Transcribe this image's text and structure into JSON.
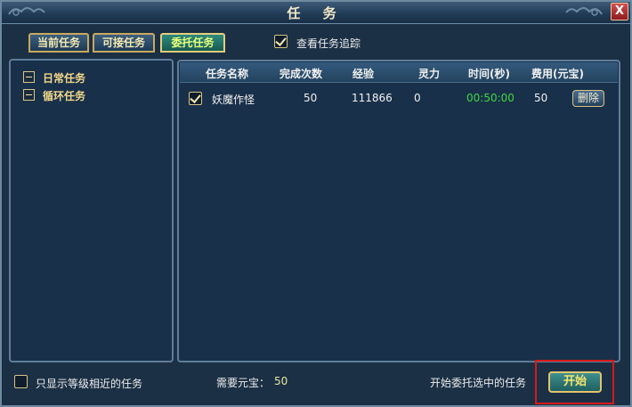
{
  "window": {
    "title": "任 务",
    "close_label": "X"
  },
  "tabs": [
    {
      "label": "当前任务",
      "active": false
    },
    {
      "label": "可接任务",
      "active": false
    },
    {
      "label": "委托任务",
      "active": true
    }
  ],
  "track_checkbox": {
    "label": "查看任务追踪",
    "checked": true
  },
  "tree": [
    {
      "label": "日常任务",
      "expanded": true
    },
    {
      "label": "循环任务",
      "expanded": true
    }
  ],
  "table": {
    "headers": [
      "任务名称",
      "完成次数",
      "经验",
      "灵力",
      "时间(秒)",
      "费用(元宝)"
    ],
    "rows": [
      {
        "checked": true,
        "name": "妖魔作怪",
        "count": "50",
        "exp": "111866",
        "spirit": "0",
        "time": "00:50:00",
        "cost": "50",
        "delete_label": "删除"
      }
    ]
  },
  "footer": {
    "filter_label": "只显示等级相近的任务",
    "filter_checked": false,
    "need_label": "需要元宝：",
    "need_value": "50",
    "start_hint": "开始委托选中的任务",
    "start_label": "开始"
  },
  "colors": {
    "accent": "#c9a85d",
    "highlight": "#d81818",
    "time_text": "#3fd93f"
  }
}
